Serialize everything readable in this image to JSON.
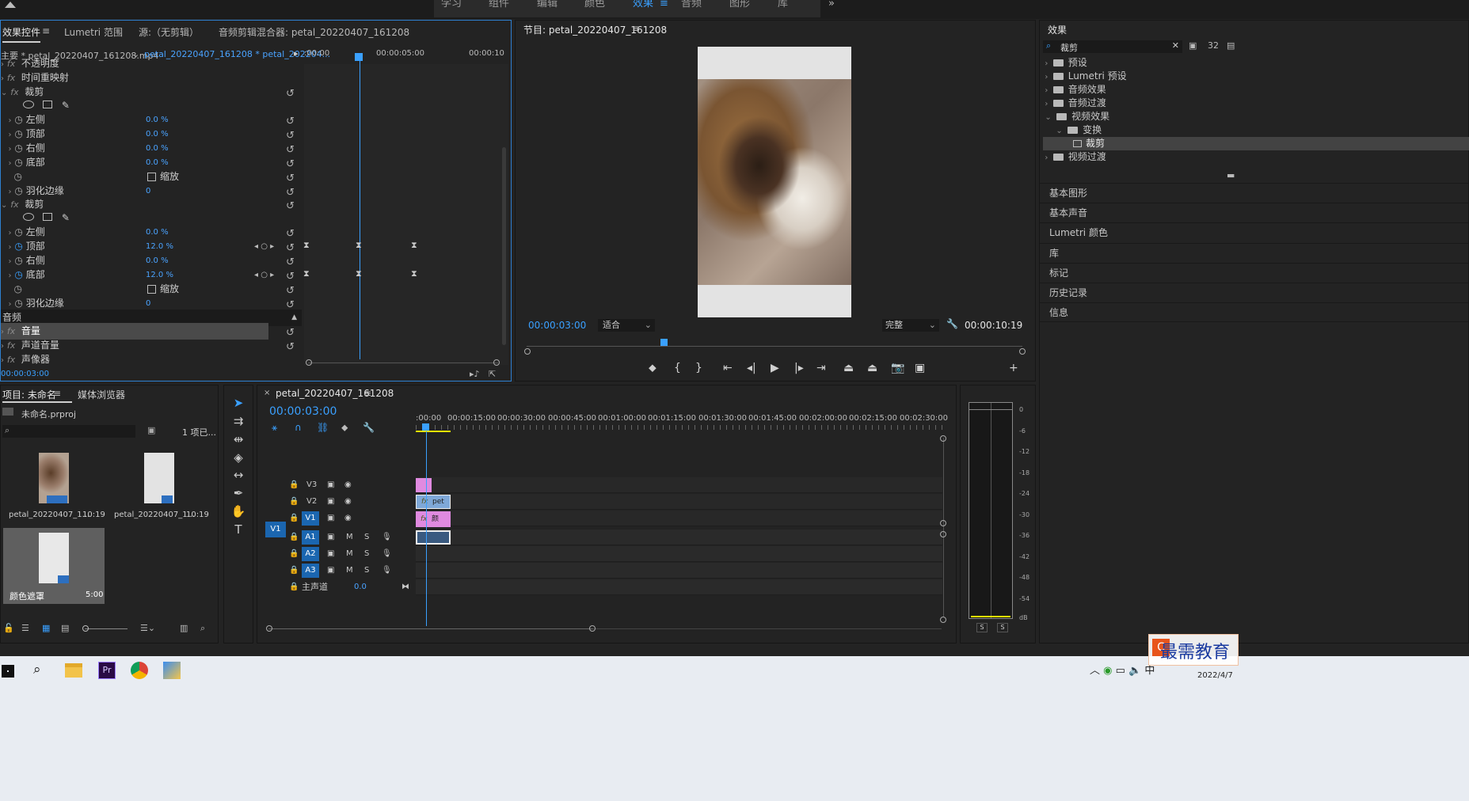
{
  "workspaces": [
    "学习",
    "组件",
    "编辑",
    "颜色",
    "效果",
    "音频",
    "图形",
    "库"
  ],
  "effect_controls": {
    "tabs": [
      "效果控件",
      "Lumetri 范围",
      "源:（无剪辑）",
      "音频剪辑混合器: petal_20220407_161208"
    ],
    "source_clip": "主要 * petal_20220407_161208.mp4",
    "seq_clip": "petal_20220407_161208 * petal_202204...",
    "ruler": [
      ":00:00",
      "00:00:05:00",
      "00:00:10"
    ],
    "rows": {
      "opacity": "不透明度",
      "time_remap": "时间重映射",
      "crop1": "裁剪",
      "left1": "左侧",
      "left1_val": "0.0 %",
      "top1": "顶部",
      "top1_val": "0.0 %",
      "right1": "右侧",
      "right1_val": "0.0 %",
      "bottom1": "底部",
      "bottom1_val": "0.0 %",
      "zoom1": "缩放",
      "feather1": "羽化边缘",
      "feather1_val": "0",
      "crop2": "裁剪",
      "left2": "左侧",
      "left2_val": "0.0 %",
      "top2": "顶部",
      "top2_val": "12.0 %",
      "right2": "右侧",
      "right2_val": "0.0 %",
      "bottom2": "底部",
      "bottom2_val": "12.0 %",
      "zoom2": "缩放",
      "feather2": "羽化边缘",
      "feather2_val": "0",
      "audio": "音频",
      "volume": "音量",
      "channel_volume": "声道音量",
      "panner": "声像器"
    },
    "timecode": "00:00:03:00"
  },
  "program": {
    "title": "节目: petal_20220407_161208",
    "timecode": "00:00:03:00",
    "fit": "适合",
    "quality": "完整",
    "duration": "00:00:10:19"
  },
  "effects_panel": {
    "title": "效果",
    "search": "裁剪",
    "tree": [
      "预设",
      "Lumetri 预设",
      "音频效果",
      "音频过渡",
      "视频效果",
      "变换",
      "裁剪",
      "视频过渡"
    ],
    "sections": [
      "基本图形",
      "基本声音",
      "Lumetri 颜色",
      "库",
      "标记",
      "历史记录",
      "信息"
    ]
  },
  "project": {
    "tabs": [
      "项目: 未命名",
      "媒体浏览器"
    ],
    "file": "未命名.prproj",
    "count": "1 项已...",
    "items": [
      {
        "name": "petal_20220407_1...",
        "dur": "10:19"
      },
      {
        "name": "petal_20220407_1...",
        "dur": "10:19"
      },
      {
        "name": "颜色遮罩",
        "dur": "5:00"
      }
    ]
  },
  "timeline": {
    "title": "petal_20220407_161208",
    "timecode": "00:00:03:00",
    "ruler": [
      ":00:00",
      "00:00:15:00",
      "00:00:30:00",
      "00:00:45:00",
      "00:01:00:00",
      "00:01:15:00",
      "00:01:30:00",
      "00:01:45:00",
      "00:02:00:00",
      "00:02:15:00",
      "00:02:30:00"
    ],
    "tracks": [
      "V3",
      "V2",
      "V1",
      "A1",
      "A2",
      "A3"
    ],
    "src_patch": "V1",
    "master": "主声道",
    "master_val": "0.0",
    "clip_v2": "pet",
    "clip_v1": "颜"
  },
  "meter": {
    "scale": [
      "0",
      "-6",
      "-12",
      "-18",
      "-24",
      "-30",
      "-36",
      "-42",
      "-48",
      "-54",
      "dB"
    ],
    "solo": [
      "S",
      "S"
    ]
  },
  "taskbar": {
    "watermark": "最需教育",
    "date": "2022/4/7"
  },
  "colors": {
    "accent": "#3aa0ff",
    "clip_pink": "#e08ae0",
    "clip_blue": "#7fa8d8",
    "bg": "#232323"
  }
}
